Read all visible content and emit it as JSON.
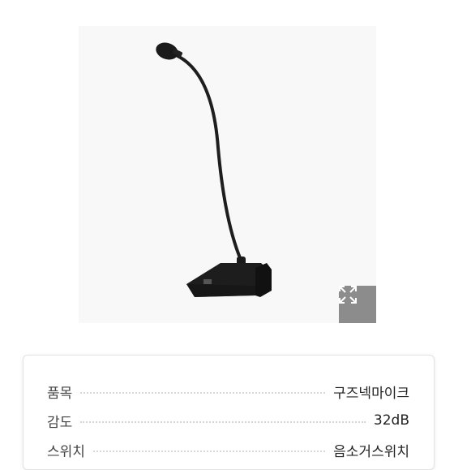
{
  "gallery": {
    "image_icon": "gooseneck-microphone",
    "expand_icon": "expand-icon"
  },
  "specs": {
    "rows": [
      {
        "label": "품목",
        "value": "구즈넥마이크"
      },
      {
        "label": "감도",
        "value": "32dB"
      },
      {
        "label": "스위치",
        "value": "음소거스위치"
      }
    ]
  },
  "colors": {
    "expand_button": "#8c8c8c",
    "image_background": "#f8f8f8",
    "microphone": "#1c1c1c"
  }
}
